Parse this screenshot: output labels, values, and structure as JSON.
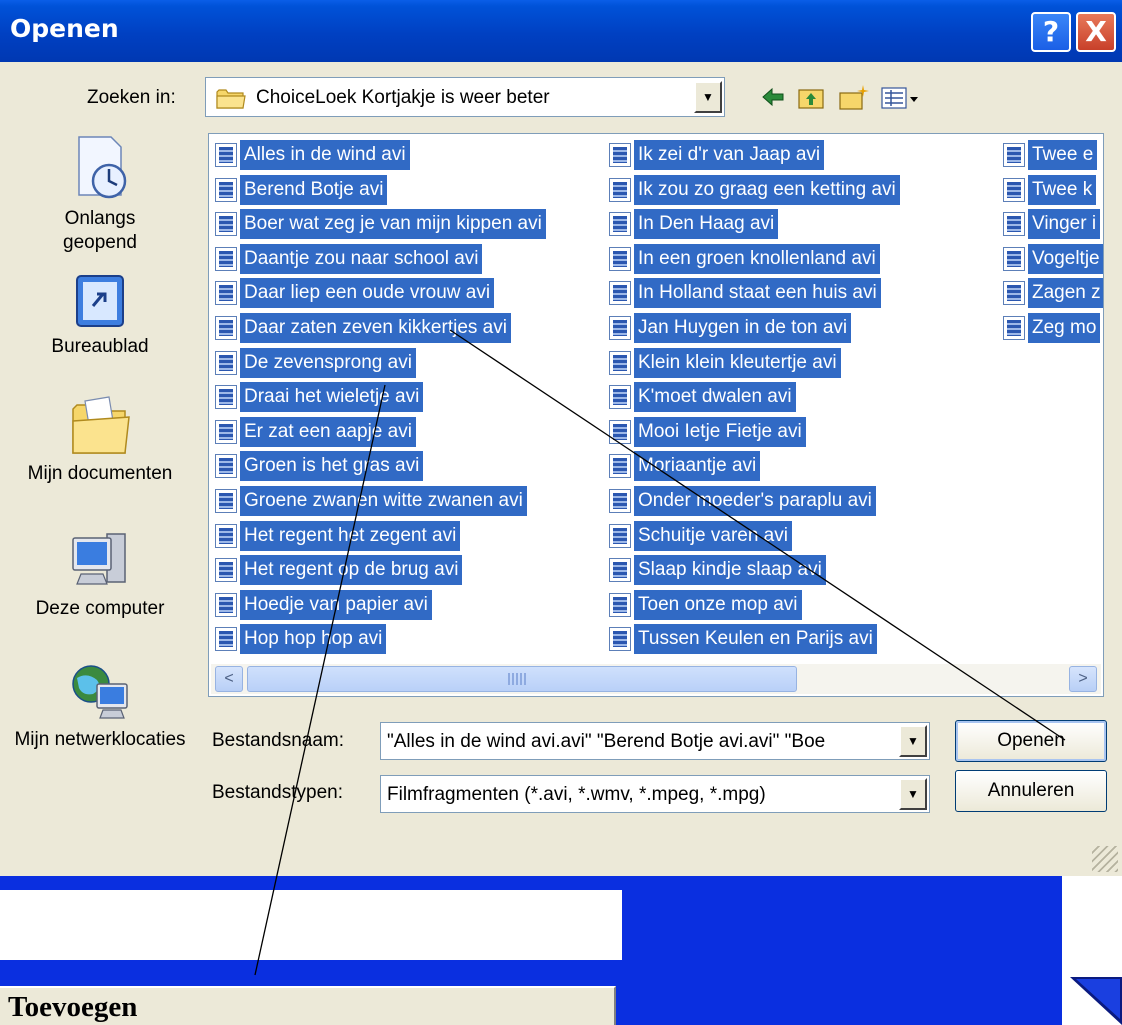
{
  "dialog": {
    "title": "Openen",
    "help_label": "?",
    "close_label": "X"
  },
  "lookin": {
    "label": "Zoeken in:",
    "value": "ChoiceLoek Kortjakje is weer beter"
  },
  "places": {
    "recent": "Onlangs geopend",
    "desktop": "Bureaublad",
    "documents": "Mijn documenten",
    "computer": "Deze computer",
    "network": "Mijn netwerklocaties"
  },
  "files": {
    "col1": [
      "Alles in de wind avi",
      "Berend Botje avi",
      "Boer wat zeg je van mijn kippen avi",
      "Daantje zou naar school avi",
      "Daar liep een oude vrouw avi",
      "Daar zaten zeven kikkertjes avi",
      "De zevensprong avi",
      "Draai het wieletje avi",
      "Er zat een aapje avi",
      "Groen is het gras avi",
      "Groene zwanen witte zwanen avi",
      "Het regent het zegent avi",
      "Het regent op de brug avi",
      "Hoedje van papier avi",
      "Hop hop hop avi"
    ],
    "col2": [
      "Ik zei d'r van Jaap avi",
      "Ik zou zo graag een ketting avi",
      "In Den Haag avi",
      "In een groen knollenland avi",
      "In Holland staat een huis avi",
      "Jan Huygen in de ton avi",
      "Klein klein kleutertje avi",
      "K'moet dwalen avi",
      "Mooi Ietje Fietje avi",
      "Moriaantje avi",
      "Onder moeder's paraplu avi",
      "Schuitje varen avi",
      "Slaap kindje slaap avi",
      "Toen onze mop avi",
      "Tussen Keulen en Parijs avi"
    ],
    "col3": [
      "Twee e",
      "Twee k",
      "Vinger i",
      "Vogeltje",
      "Zagen z",
      "Zeg mo"
    ]
  },
  "scrollbar": {
    "left_arrow": "<",
    "right_arrow": ">"
  },
  "filename": {
    "label": "Bestandsnaam:",
    "value": "\"Alles in de wind avi.avi\" \"Berend Botje avi.avi\" \"Boe"
  },
  "filetype": {
    "label": "Bestandstypen:",
    "value": "Filmfragmenten (*.avi, *.wmv, *.mpeg, *.mpg)"
  },
  "buttons": {
    "open": "Openen",
    "cancel": "Annuleren"
  },
  "background_app": {
    "add_button": "Toevoegen"
  },
  "colors": {
    "titlebar": "#0040c2",
    "selection": "#316ac5",
    "dialog_bg": "#ece9d8",
    "app_blue": "#0a2fe0"
  }
}
